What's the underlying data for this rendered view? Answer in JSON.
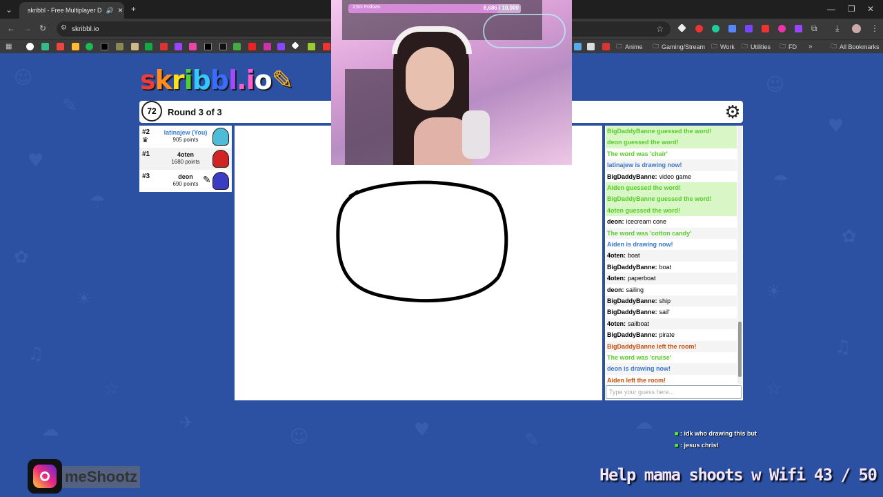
{
  "browser": {
    "tab_title": "skribbl - Free Multiplayer D",
    "url": "skribbl.io",
    "bookmarks": [
      "Anime",
      "Gaming/Stream",
      "Work",
      "Utilities",
      "FD",
      "All Bookmarks"
    ]
  },
  "game": {
    "logo": "skribbl.io",
    "timer": "72",
    "round": "Round 3 of 3",
    "players": [
      {
        "rank": "#2",
        "name": "latinajew (You)",
        "points": "905 points",
        "color": "#4fbcd7",
        "name_color": "#3a7fd8"
      },
      {
        "rank": "#1",
        "name": "4oten",
        "points": "1680 points",
        "color": "#d02323",
        "name_color": "#111111"
      },
      {
        "rank": "#3",
        "name": "deon",
        "points": "690 points",
        "color": "#3b3bc4",
        "name_color": "#111111"
      }
    ],
    "chat": [
      {
        "user": "BigDaddyBanne guessed the word!",
        "text": "",
        "type": "guess"
      },
      {
        "user": "deon guessed the word!",
        "text": "",
        "type": "guess"
      },
      {
        "user": "The word was 'chair'",
        "text": "",
        "type": "word"
      },
      {
        "user": "latinajew is drawing now!",
        "text": "",
        "type": "drawing"
      },
      {
        "user": "BigDaddyBanne:",
        "text": "video game",
        "type": "normal"
      },
      {
        "user": "Aiden guessed the word!",
        "text": "",
        "type": "guess"
      },
      {
        "user": "BigDaddyBanne guessed the word!",
        "text": "",
        "type": "guess"
      },
      {
        "user": "4oten guessed the word!",
        "text": "",
        "type": "guess"
      },
      {
        "user": "deon:",
        "text": "icecream cone",
        "type": "normal"
      },
      {
        "user": "The word was 'cotton candy'",
        "text": "",
        "type": "word"
      },
      {
        "user": "Aiden is drawing now!",
        "text": "",
        "type": "drawing"
      },
      {
        "user": "4oten:",
        "text": "boat",
        "type": "normal"
      },
      {
        "user": "BigDaddyBanne:",
        "text": "boat",
        "type": "normal"
      },
      {
        "user": "4oten:",
        "text": "paperboat",
        "type": "normal"
      },
      {
        "user": "deon:",
        "text": "sailing",
        "type": "normal"
      },
      {
        "user": "BigDaddyBanne:",
        "text": "ship",
        "type": "normal"
      },
      {
        "user": "BigDaddyBanne:",
        "text": "sail'",
        "type": "normal"
      },
      {
        "user": "4oten:",
        "text": "sailboat",
        "type": "normal"
      },
      {
        "user": "BigDaddyBanne:",
        "text": "pirate",
        "type": "normal"
      },
      {
        "user": "BigDaddyBanne left the room!",
        "text": "",
        "type": "left"
      },
      {
        "user": "The word was 'cruise'",
        "text": "",
        "type": "word"
      },
      {
        "user": "deon is drawing now!",
        "text": "",
        "type": "drawing"
      },
      {
        "user": "Aiden left the room!",
        "text": "",
        "type": "left"
      }
    ],
    "guess_placeholder": "Type your guess here..."
  },
  "stream": {
    "follow_goal_label": "XSG Follows",
    "follow_goal_count": "8,686 / 10,000",
    "follow_goal_progress": 0.8686,
    "twitch_chat": [
      {
        "user": "",
        "text": ": idk who drawing this but"
      },
      {
        "user": "",
        "text": ": jesus christ"
      }
    ],
    "goal_banner": "Help mama shoots w Wifi  43 / 50",
    "instagram_handle": "meShootz"
  }
}
